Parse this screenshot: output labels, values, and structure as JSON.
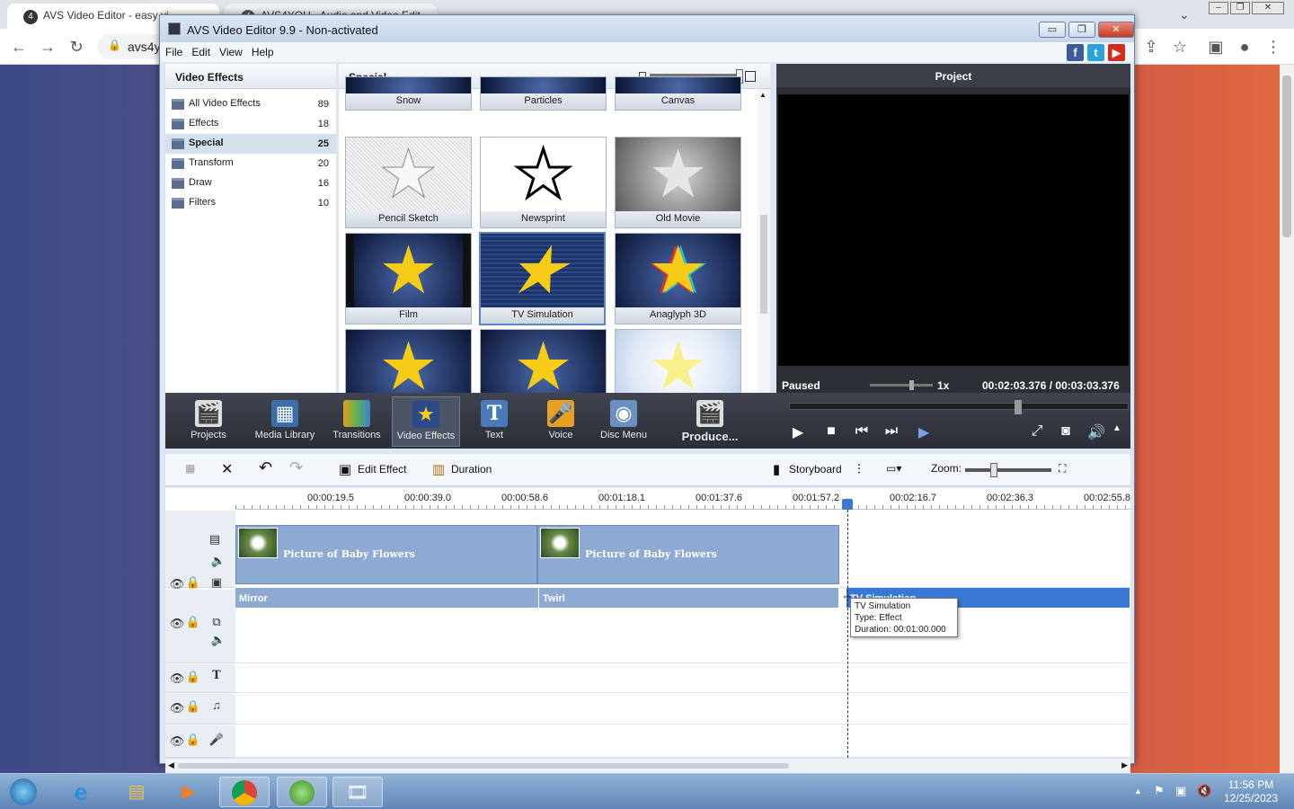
{
  "browser": {
    "tab1_title": "AVS Video Editor - easy vi",
    "tab2_title": "AVS4YOU - Audio and Video Edit",
    "address_text": "avs4y"
  },
  "app": {
    "title": "AVS Video Editor 9.9 - Non-activated",
    "menu": [
      "File",
      "Edit",
      "View",
      "Help"
    ]
  },
  "categories": {
    "header": "Video Effects",
    "items": [
      {
        "label": "All Video Effects",
        "count": "89"
      },
      {
        "label": "Effects",
        "count": "18"
      },
      {
        "label": "Special",
        "count": "25"
      },
      {
        "label": "Transform",
        "count": "20"
      },
      {
        "label": "Draw",
        "count": "16"
      },
      {
        "label": "Filters",
        "count": "10"
      }
    ]
  },
  "effects": {
    "header": "Special",
    "tiles": [
      "Snow",
      "Particles",
      "Canvas",
      "Pencil Sketch",
      "Newsprint",
      "Old Movie",
      "Film",
      "TV Simulation",
      "Anaglyph 3D"
    ]
  },
  "preview": {
    "header": "Project",
    "status": "Paused",
    "speed": "1x",
    "time": "00:02:03.376  /  00:03:03.376"
  },
  "toolbar": {
    "items": [
      "Projects",
      "Media Library",
      "Transitions",
      "Video Effects",
      "Text",
      "Voice",
      "Disc Menu",
      "Produce..."
    ]
  },
  "timeline_bar": {
    "edit_effect": "Edit Effect",
    "duration": "Duration",
    "storyboard": "Storyboard",
    "zoom": "Zoom:"
  },
  "timeline": {
    "ticks": [
      "00:00:19.5",
      "00:00:39.0",
      "00:00:58.6",
      "00:01:18.1",
      "00:01:37.6",
      "00:01:57.2",
      "00:02:16.7",
      "00:02:36.3",
      "00:02:55.8"
    ],
    "clips": [
      "Picture of Baby Flowers",
      "Picture of Baby Flowers"
    ],
    "effects": [
      "Mirror",
      "Twirl",
      "TV Simulation"
    ],
    "tooltip": {
      "line1": "TV Simulation",
      "line2": "Type: Effect",
      "line3": "Duration: 00:01:00.000"
    }
  },
  "taskbar": {
    "time": "11:56 PM",
    "date": "12/25/2023"
  }
}
